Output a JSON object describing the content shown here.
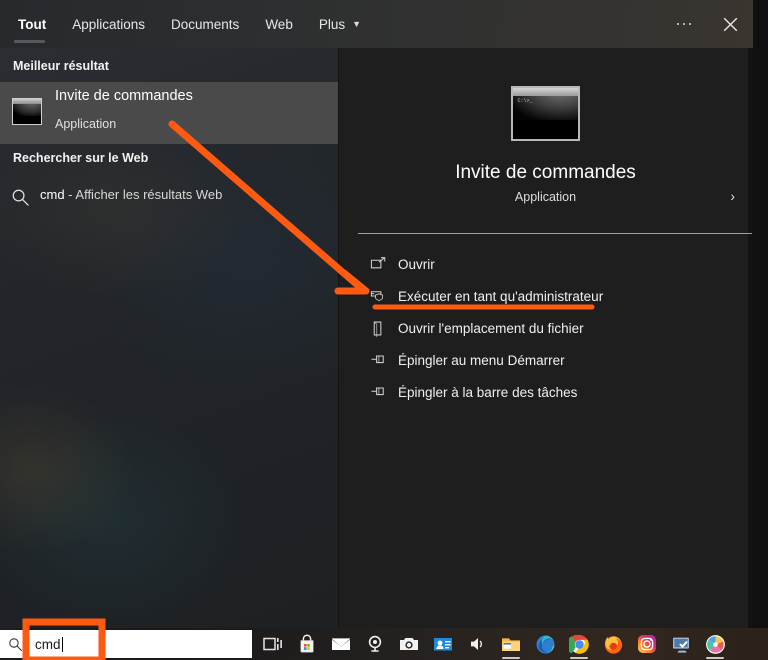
{
  "window": {
    "tabs": [
      {
        "label": "Tout",
        "active": true
      },
      {
        "label": "Applications",
        "active": false
      },
      {
        "label": "Documents",
        "active": false
      },
      {
        "label": "Web",
        "active": false
      },
      {
        "label": "Plus",
        "active": false,
        "caret": "▼"
      }
    ],
    "more_options_icon": "ellipsis-icon",
    "close_icon": "close-icon"
  },
  "left_pane": {
    "best_result_heading": "Meilleur résultat",
    "best_result": {
      "title": "Invite de commandes",
      "subtitle": "Application",
      "icon": "command-prompt-icon",
      "icon_prompt_text": "C:\\>_"
    },
    "web_heading": "Rechercher sur le Web",
    "web_result": {
      "query": "cmd",
      "suffix": " - Afficher les résultats Web",
      "icon": "search-icon",
      "chevron": "›"
    }
  },
  "right_pane": {
    "app_title": "Invite de commandes",
    "app_type": "Application",
    "app_icon": "command-prompt-icon",
    "app_icon_prompt_text": "C:\\>_",
    "menu": [
      {
        "label": "Ouvrir",
        "icon": "open-window-icon"
      },
      {
        "label": "Exécuter en tant qu'administrateur",
        "icon": "shield-window-icon",
        "highlighted": true
      },
      {
        "label": "Ouvrir l'emplacement du fichier",
        "icon": "folder-icon"
      },
      {
        "label": "Épingler au menu Démarrer",
        "icon": "pin-icon"
      },
      {
        "label": "Épingler à la barre des tâches",
        "icon": "pin-icon"
      }
    ]
  },
  "taskbar": {
    "search": {
      "value": "cmd",
      "icon": "search-icon"
    },
    "icons": [
      {
        "name": "task-view-icon",
        "running": false
      },
      {
        "name": "microsoft-store-icon",
        "running": false
      },
      {
        "name": "mail-icon",
        "running": false
      },
      {
        "name": "webcam-icon",
        "running": false
      },
      {
        "name": "camera-icon",
        "running": false
      },
      {
        "name": "people-photos-icon",
        "running": false
      },
      {
        "name": "speaker-icon",
        "running": false
      },
      {
        "name": "file-explorer-icon",
        "running": true
      },
      {
        "name": "microsoft-edge-icon",
        "running": false
      },
      {
        "name": "google-chrome-icon",
        "running": true
      },
      {
        "name": "mozilla-firefox-icon",
        "running": false
      },
      {
        "name": "instagram-icon",
        "running": false
      },
      {
        "name": "remote-desktop-icon",
        "running": false
      },
      {
        "name": "color-wheel-app-icon",
        "running": true
      }
    ]
  },
  "annotations": {
    "accent_color": "#ff5a11",
    "arrow": "arrow-pointing-to-run-as-administrator",
    "underline": "underline-run-as-administrator",
    "highlight_box": "highlight-box-search-input"
  }
}
